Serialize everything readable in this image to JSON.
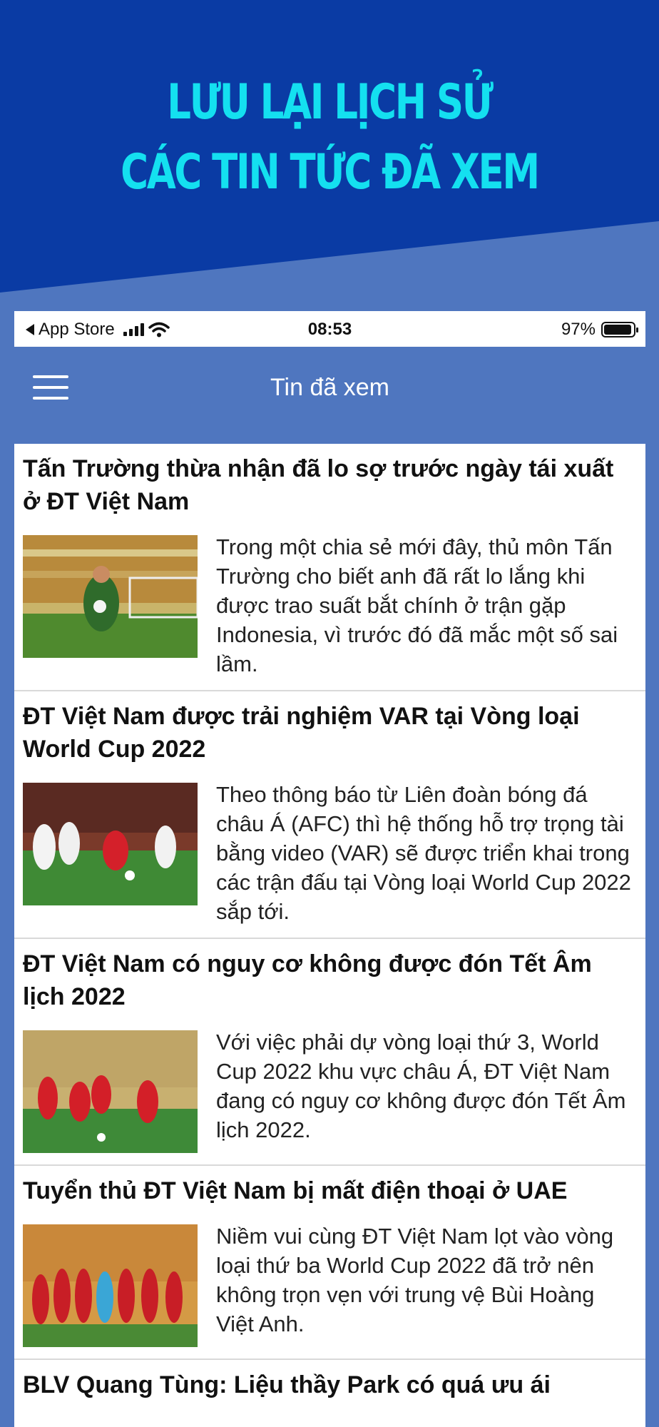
{
  "promo": {
    "line1": "LƯU LẠI LỊCH SỬ",
    "line2": "CÁC TIN TỨC ĐÃ XEM"
  },
  "status_bar": {
    "back_label": "App Store",
    "time": "08:53",
    "battery": "97%"
  },
  "nav": {
    "title": "Tin đã xem"
  },
  "articles": [
    {
      "title": "Tấn Trường thừa nhận đã lo sợ trước ngày tái xuất ở ĐT Việt Nam",
      "excerpt": "Trong một chia sẻ mới đây, thủ môn Tấn Trường cho biết anh đã rất lo lắng khi được trao suất bắt chính ở trận gặp Indonesia, vì trước đó đã mắc một số sai lầm."
    },
    {
      "title": "ĐT Việt Nam được trải nghiệm VAR tại Vòng loại World Cup 2022",
      "excerpt": "Theo thông báo từ Liên đoàn bóng đá châu Á (AFC) thì hệ thống hỗ trợ trọng tài bằng video (VAR) sẽ được triển khai trong các trận đấu tại Vòng loại World Cup 2022 sắp tới."
    },
    {
      "title": "ĐT Việt Nam có nguy cơ không được đón Tết Âm lịch 2022",
      "excerpt": "Với việc phải dự vòng loại thứ 3, World Cup 2022 khu vực châu Á, ĐT Việt Nam đang có nguy cơ không được đón Tết Âm lịch 2022."
    },
    {
      "title": "Tuyển thủ ĐT Việt Nam bị mất điện thoại ở UAE",
      "excerpt": "Niềm vui cùng ĐT Việt Nam lọt vào vòng loại thứ ba World Cup 2022 đã trở nên không trọn vẹn với trung vệ Bùi Hoàng Việt Anh."
    },
    {
      "title": "BLV Quang Tùng: Liệu thầy Park có quá ưu ái",
      "excerpt": ""
    }
  ],
  "colors": {
    "promo_band": "#0a3ba4",
    "background": "#4f76bf",
    "promo_text": "#14e0f0"
  }
}
